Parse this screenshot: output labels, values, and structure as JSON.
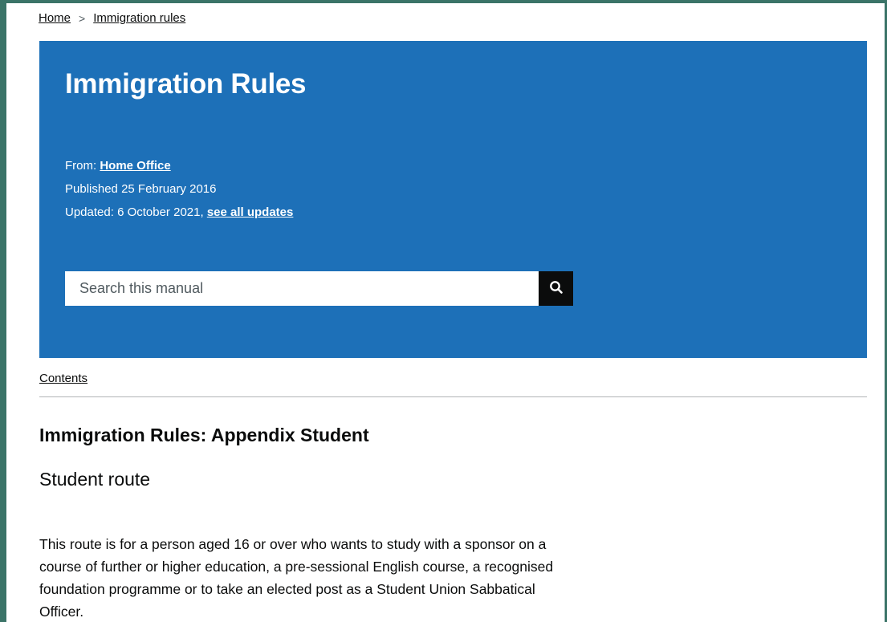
{
  "breadcrumb": {
    "items": [
      "Home",
      "Immigration rules"
    ],
    "separator": ">"
  },
  "banner": {
    "title": "Immigration Rules",
    "from_label": "From:",
    "from_org": "Home Office",
    "published_label": "Published",
    "published_date": "25 February 2016",
    "updated_label": "Updated:",
    "updated_date": "6 October 2021,",
    "updates_link": "see all updates"
  },
  "search": {
    "placeholder": "Search this manual",
    "button_icon": "search-icon"
  },
  "nav": {
    "contents_link": "Contents"
  },
  "content": {
    "doc_title": "Immigration Rules: Appendix Student",
    "section_title": "Student route",
    "paragraph": "This route is for a person aged 16 or over who wants to study with a sponsor on a course of further or higher education, a pre-sessional English course, a recognised foundation programme or to take an elected post as a Student Union Sabbatical Officer."
  },
  "colors": {
    "banner_bg": "#1d70b8",
    "page_bg": "#ffffff",
    "outer_bg": "#3b7468",
    "text": "#0b0c0c",
    "search_button_bg": "#0b0c0c"
  }
}
